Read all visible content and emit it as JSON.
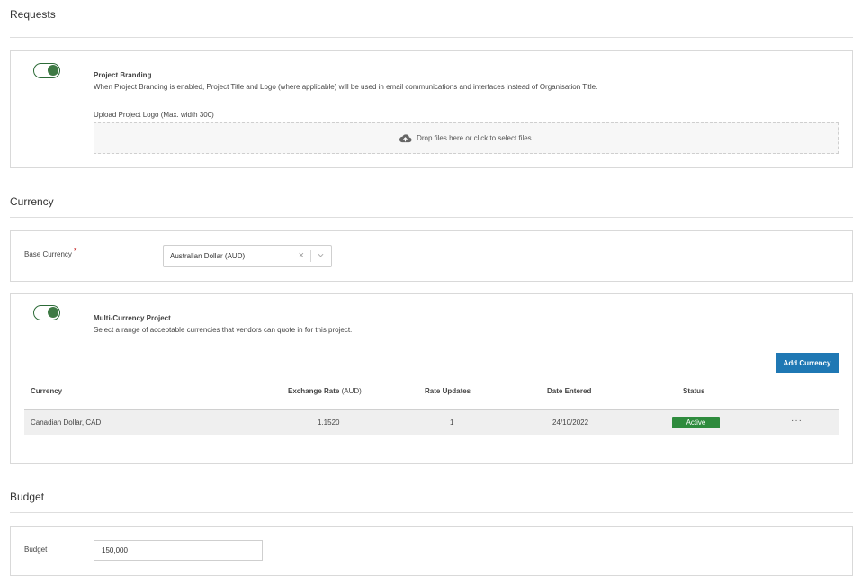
{
  "requests": {
    "title": "Requests",
    "branding": {
      "enabled": true,
      "title": "Project Branding",
      "description": "When Project Branding is enabled, Project Title and Logo (where applicable) will be used in email communications and interfaces instead of Organisation Title.",
      "upload_label": "Upload Project Logo (Max. width 300)",
      "dropzone_text": "Drop files here or click to select files."
    }
  },
  "currency": {
    "title": "Currency",
    "base_label": "Base Currency",
    "required_mark": "*",
    "base_value": "Australian Dollar (AUD)",
    "clear_glyph": "×",
    "multi": {
      "enabled": true,
      "title": "Multi-Currency Project",
      "description": "Select a range of acceptable currencies that vendors can quote in for this project.",
      "add_button": "Add Currency",
      "columns": {
        "currency": "Currency",
        "exchange_rate": "Exchange Rate",
        "exchange_rate_unit": "(AUD)",
        "rate_updates": "Rate Updates",
        "date_entered": "Date Entered",
        "status": "Status"
      },
      "rows": [
        {
          "currency": "Canadian Dollar, CAD",
          "exchange_rate": "1.1520",
          "rate_updates": "1",
          "date_entered": "24/10/2022",
          "status": "Active",
          "actions": "···"
        }
      ]
    }
  },
  "budget": {
    "title": "Budget",
    "label": "Budget",
    "value": "150,000"
  },
  "colors": {
    "toggle_on": "#2d6b38",
    "primary": "#1f78b4",
    "active_badge": "#2e8b3d",
    "required": "#c62828"
  },
  "icons": {
    "upload": "cloud-upload-icon",
    "clear": "close-icon",
    "dropdown": "chevron-down-icon",
    "actions": "more-horizontal-icon"
  }
}
